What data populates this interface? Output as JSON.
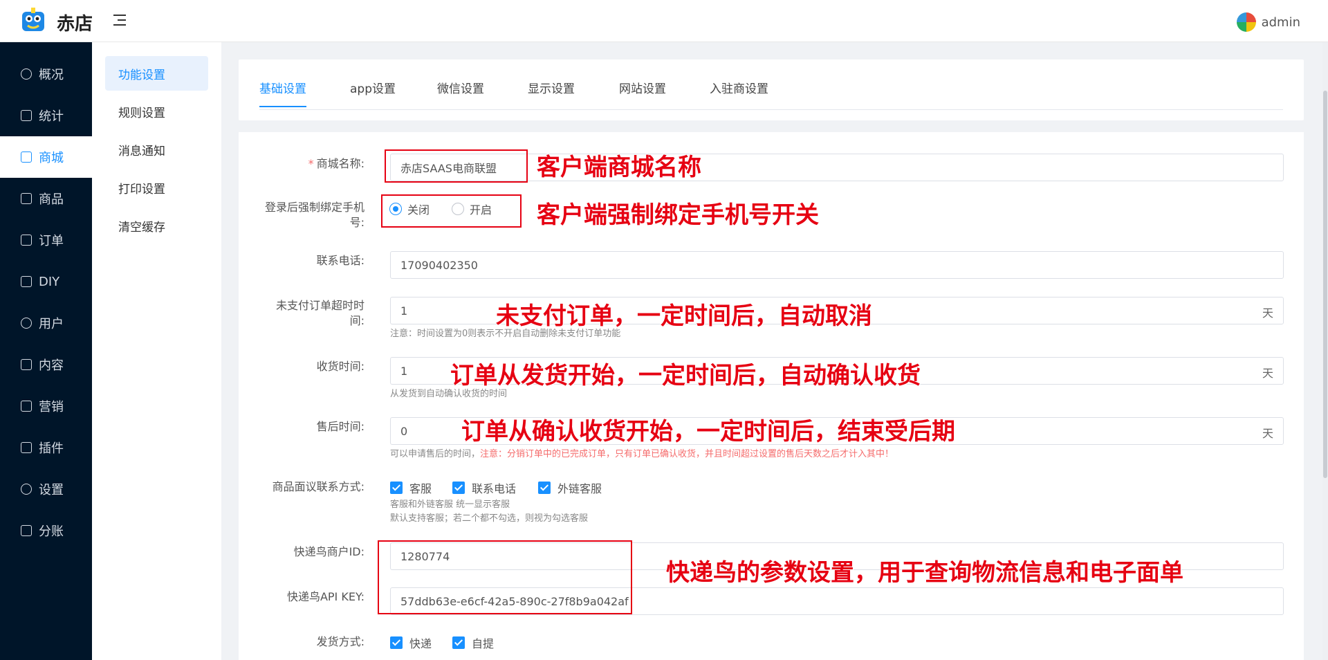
{
  "header": {
    "brand": "赤店",
    "user": "admin"
  },
  "sidenav": {
    "items": [
      {
        "label": "概况",
        "icon": "dashboard-icon"
      },
      {
        "label": "统计",
        "icon": "stats-icon"
      },
      {
        "label": "商城",
        "icon": "store-icon"
      },
      {
        "label": "商品",
        "icon": "goods-icon"
      },
      {
        "label": "订单",
        "icon": "order-icon"
      },
      {
        "label": "DIY",
        "icon": "diy-icon"
      },
      {
        "label": "用户",
        "icon": "user-icon"
      },
      {
        "label": "内容",
        "icon": "content-icon"
      },
      {
        "label": "营销",
        "icon": "marketing-icon"
      },
      {
        "label": "插件",
        "icon": "plugin-icon"
      },
      {
        "label": "设置",
        "icon": "gear-icon"
      },
      {
        "label": "分账",
        "icon": "split-icon"
      }
    ],
    "active": "商城"
  },
  "subnav": {
    "items": [
      "功能设置",
      "规则设置",
      "消息通知",
      "打印设置",
      "清空缓存"
    ],
    "active": "功能设置"
  },
  "tabs": [
    "基础设置",
    "app设置",
    "微信设置",
    "显示设置",
    "网站设置",
    "入驻商设置"
  ],
  "form": {
    "mall_name": {
      "label": "商城名称:",
      "value": "赤店SAAS电商联盟"
    },
    "bind_phone": {
      "label_1": "登录后强制绑定手机",
      "label_2": "号:",
      "off": "关闭",
      "on": "开启"
    },
    "phone": {
      "label": "联系电话:",
      "value": "17090402350"
    },
    "unpaid_timeout": {
      "label_1": "未支付订单超时时",
      "label_2": "间:",
      "value": "1",
      "suffix": "天",
      "hint": "注意：时间设置为0则表示不开启自动删除未支付订单功能"
    },
    "receive_time": {
      "label": "收货时间:",
      "value": "1",
      "suffix": "天",
      "hint": "从发货到自动确认收货的时间"
    },
    "after_sale": {
      "label": "售后时间:",
      "value": "0",
      "suffix": "天",
      "hint_1": "可以申请售后的时间，",
      "hint_warn": "注意：分销订单中的已完成订单，只有订单已确认收货，并且时间超过设置的售后天数之后才计入其中！"
    },
    "contact": {
      "label": "商品面议联系方式:",
      "opt1": "客服",
      "opt2": "联系电话",
      "opt3": "外链客服",
      "hint_1": "客服和外链客服 统一显示客服",
      "hint_2": "默认支持客服；若二个都不勾选，则视为勾选客服"
    },
    "kdn_id": {
      "label": "快递鸟商户ID:",
      "value": "1280774"
    },
    "kdn_key": {
      "label": "快递鸟API KEY:",
      "value": "57ddb63e-e6cf-42a5-890c-27f8b9a042af"
    },
    "delivery": {
      "label": "发货方式:",
      "opt1": "快递",
      "opt2": "自提"
    }
  },
  "annotations": {
    "a1": "客户端商城名称",
    "a2": "客户端强制绑定手机号开关",
    "a3": "未支付订单，一定时间后，自动取消",
    "a4": "订单从发货开始，一定时间后，自动确认收货",
    "a5": "订单从确认收货开始，一定时间后，结束受后期",
    "a6": "快递鸟的参数设置，用于查询物流信息和电子面单"
  },
  "colors": {
    "primary": "#1890ff",
    "sidebar": "#001529",
    "annotation": "#e60012"
  }
}
